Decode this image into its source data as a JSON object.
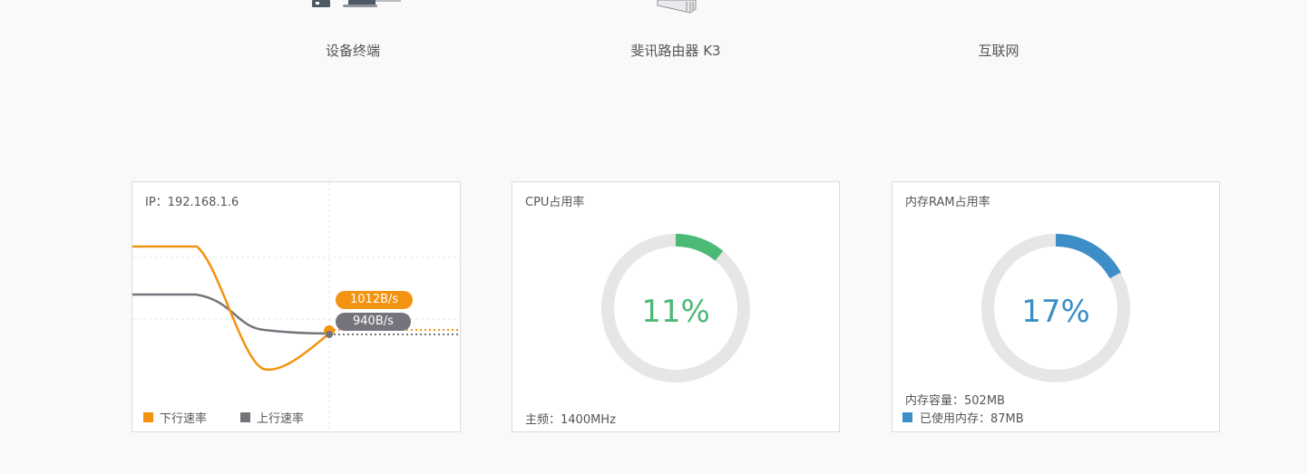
{
  "topology": {
    "device_label": "设备终端",
    "router_label": "斐讯路由器 K3",
    "internet_label": "互联网",
    "device_icon": "desktop-computer-icon",
    "router_icon": "router-icon"
  },
  "traffic_panel": {
    "ip_text": "IP：192.168.1.6",
    "download_value": "1012B/s",
    "upload_value": "940B/s",
    "legend_download": "下行速率",
    "legend_upload": "上行速率",
    "colors": {
      "download": "#f39312",
      "upload": "#75747c"
    }
  },
  "cpu_panel": {
    "title": "CPU占用率",
    "percent_text": "11%",
    "percent": 11,
    "freq_text": "主频：1400MHz",
    "color": "#4cb976"
  },
  "ram_panel": {
    "title": "内存RAM占用率",
    "percent_text": "17%",
    "percent": 17,
    "capacity_text": "内存容量：502MB",
    "used_text": "已使用内存：87MB",
    "color": "#3b8ec6"
  }
}
